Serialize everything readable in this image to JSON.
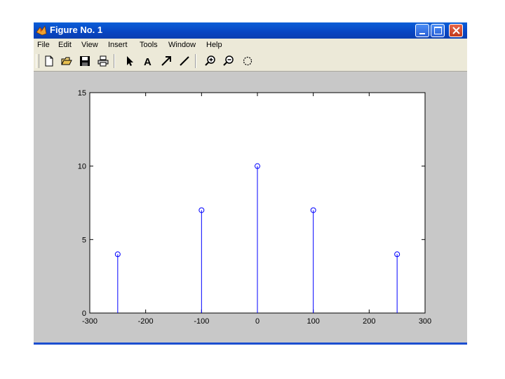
{
  "window": {
    "title": "Figure No. 1"
  },
  "menu": [
    "File",
    "Edit",
    "View",
    "Insert",
    "Tools",
    "Window",
    "Help"
  ],
  "toolbar": [
    "new-icon",
    "open-icon",
    "save-icon",
    "print-icon",
    "arrow-icon",
    "text-icon",
    "draw-arrow-icon",
    "line-icon",
    "zoom-in-icon",
    "zoom-out-icon",
    "rotate-icon"
  ],
  "colors": {
    "titlebar": "#0845c2",
    "stem": "#0000ff",
    "axes_bg": "#ffffff",
    "figure_bg": "#c8c8c8"
  },
  "chart_data": {
    "type": "stem",
    "title": "",
    "xlabel": "",
    "ylabel": "",
    "xlim": [
      -300,
      300
    ],
    "ylim": [
      0,
      15
    ],
    "x": [
      -250,
      -100,
      0,
      100,
      250
    ],
    "y": [
      4,
      7,
      10,
      7,
      4
    ],
    "xticks": [
      "-300",
      "-200",
      "-100",
      "0",
      "100",
      "200",
      "300"
    ],
    "yticks": [
      "0",
      "5",
      "10",
      "15"
    ],
    "marker": "circle",
    "grid": false
  }
}
